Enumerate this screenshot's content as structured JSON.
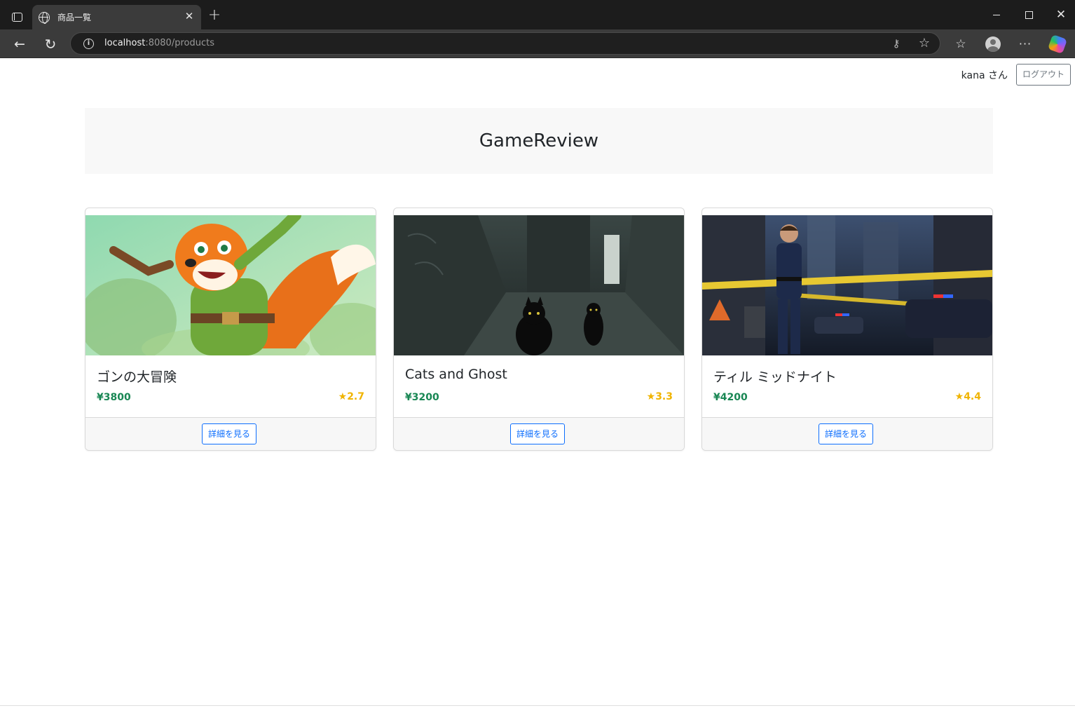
{
  "browser": {
    "tab_title": "商品一覧",
    "url_host": "localhost",
    "url_rest": ":8080/products",
    "icons": [
      "tab-actions-icon",
      "globe-icon",
      "close-icon",
      "plus-icon",
      "minimize-icon",
      "maximize-icon",
      "window-close-icon",
      "back-icon",
      "reload-icon",
      "info-icon",
      "key-icon",
      "star-icon",
      "favorites-icon",
      "profile-icon",
      "more-icon",
      "copilot-icon"
    ]
  },
  "header": {
    "username": "kana さん",
    "logout_label": "ログアウト"
  },
  "hero": {
    "title": "GameReview"
  },
  "products": [
    {
      "title": "ゴンの大冒険",
      "price": "¥3800",
      "rating": "★2.7",
      "button": "詳細を見る"
    },
    {
      "title": "Cats and Ghost",
      "price": "¥3200",
      "rating": "★3.3",
      "button": "詳細を見る"
    },
    {
      "title": "ティル ミッドナイト",
      "price": "¥4200",
      "rating": "★4.4",
      "button": "詳細を見る"
    }
  ],
  "colors": {
    "price": "#198754",
    "rating": "#f0b400",
    "primary": "#0d6efd"
  }
}
